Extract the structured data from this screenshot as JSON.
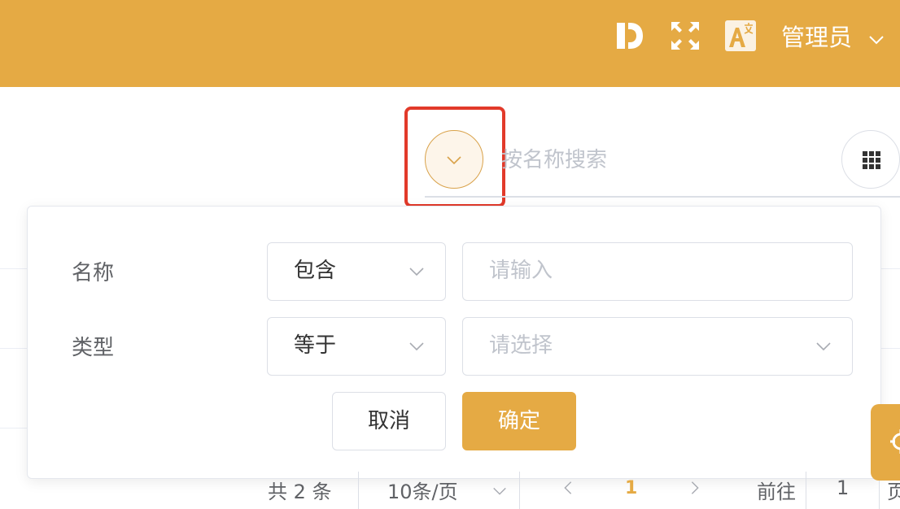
{
  "header": {
    "user_name": "管理员",
    "icons": [
      "doc-d-icon",
      "fullscreen-icon",
      "translate-icon",
      "chevron-down-icon"
    ],
    "bg_color": "#e5aa44"
  },
  "toolbar": {
    "search_placeholder": "按名称搜索",
    "filter_toggle_icon": "chevron-down-icon",
    "grid_icon": "grid-icon"
  },
  "filter_panel": {
    "rows": [
      {
        "label": "名称",
        "operator": "包含",
        "value_placeholder": "请输入",
        "value_type": "input"
      },
      {
        "label": "类型",
        "operator": "等于",
        "value_placeholder": "请选择",
        "value_type": "select"
      }
    ],
    "cancel_label": "取消",
    "confirm_label": "确定"
  },
  "pagination": {
    "total_text": "共 2 条",
    "page_size": "10条/页",
    "current_page": "1",
    "goto_label": "前往",
    "goto_value": "1",
    "page_suffix": "页"
  },
  "colors": {
    "accent": "#e5aa44",
    "highlight": "#e23a2a"
  }
}
